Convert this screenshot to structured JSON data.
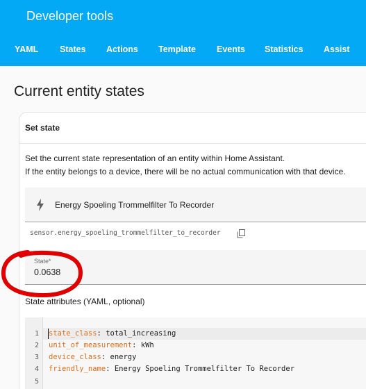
{
  "header": {
    "title": "Developer tools",
    "background_color": "#03a9f4",
    "tabs": [
      {
        "label": "YAML"
      },
      {
        "label": "States",
        "active": true
      },
      {
        "label": "Actions"
      },
      {
        "label": "Template"
      },
      {
        "label": "Events"
      },
      {
        "label": "Statistics"
      },
      {
        "label": "Assist"
      }
    ]
  },
  "page": {
    "title": "Current entity states"
  },
  "set_state": {
    "header": "Set state",
    "description_line1": "Set the current state representation of an entity within Home Assistant.",
    "description_line2": "If the entity belongs to a device, there will be no actual communication with that device.",
    "entity": {
      "icon": "flash-icon",
      "name": "Energy Spoeling Trommelfilter To Recorder",
      "entity_id": "sensor.energy_spoeling_trommelfilter_to_recorder"
    },
    "state_field": {
      "label": "State*",
      "value": "0.0638"
    },
    "attributes_label": "State attributes (YAML, optional)",
    "editor": {
      "lines": [
        {
          "number": "1",
          "key": "state_class",
          "sep": ": ",
          "value": "total_increasing"
        },
        {
          "number": "2",
          "key": "unit_of_measurement",
          "sep": ": ",
          "value": "kWh"
        },
        {
          "number": "3",
          "key": "device_class",
          "sep": ": ",
          "value": "energy"
        },
        {
          "number": "4",
          "key": "friendly_name",
          "sep": ": ",
          "value": "Energy Spoeling Trommelfilter To Recorder"
        },
        {
          "number": "5",
          "key": "",
          "sep": "",
          "value": ""
        }
      ]
    }
  },
  "annotation_color": "#e00000"
}
